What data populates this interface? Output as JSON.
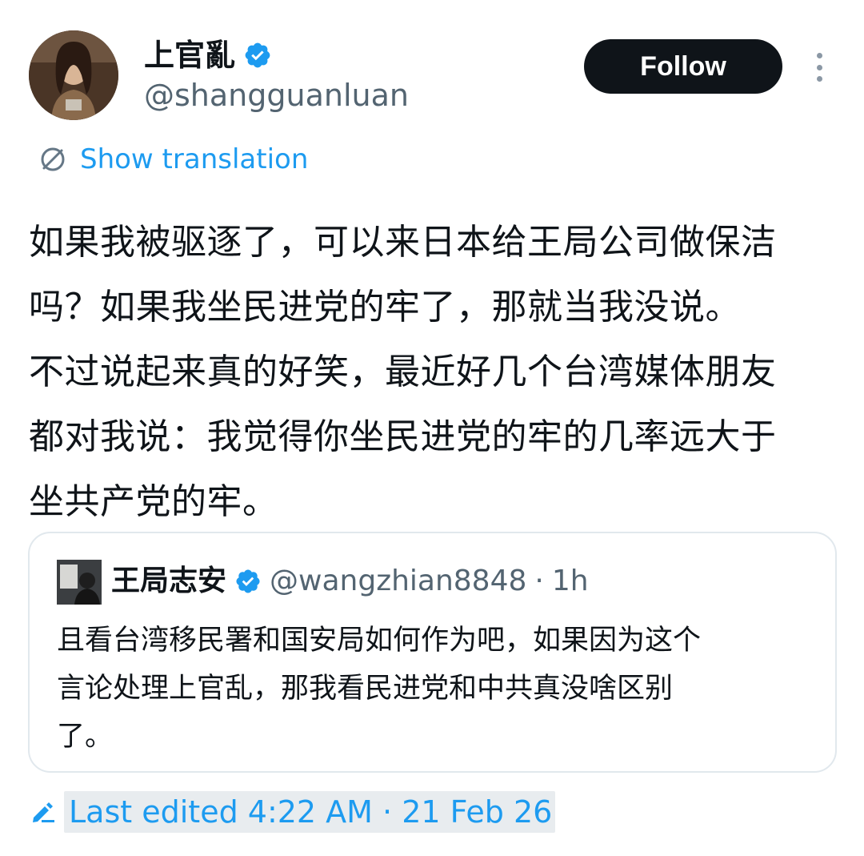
{
  "author": {
    "display_name": "上官亂",
    "handle": "@shangguanluan",
    "verified_icon": "verified-badge-icon",
    "avatar_icon": "avatar"
  },
  "actions": {
    "follow_label": "Follow",
    "more_icon": "more-options-icon"
  },
  "translation": {
    "label": "Show translation",
    "icon": "globe-translate-icon"
  },
  "tweet": {
    "text": "如果我被驱逐了，可以来日本给王局公司做保洁\n吗？如果我坐民进党的牢了，那就当我没说。\n不过说起来真的好笑，最近好几个台湾媒体朋友\n都对我说：我觉得你坐民进党的牢的几率远大于\n坐共产党的牢。"
  },
  "quote": {
    "display_name": "王局志安",
    "handle": "@wangzhian8848",
    "separator": "·",
    "time": "1h",
    "text": "且看台湾移民署和国安局如何作为吧，如果因为这个\n言论处理上官乱，那我看民进党和中共真没啥区别\n了。"
  },
  "edited": {
    "label": "Last edited 4:22 AM · 21 Feb 26",
    "icon": "edit-pencil-icon"
  },
  "colors": {
    "accent": "#1d9bf0",
    "text_primary": "#0f1419",
    "text_secondary": "#536471",
    "border": "#e1e8ed",
    "follow_bg": "#0f1419"
  }
}
